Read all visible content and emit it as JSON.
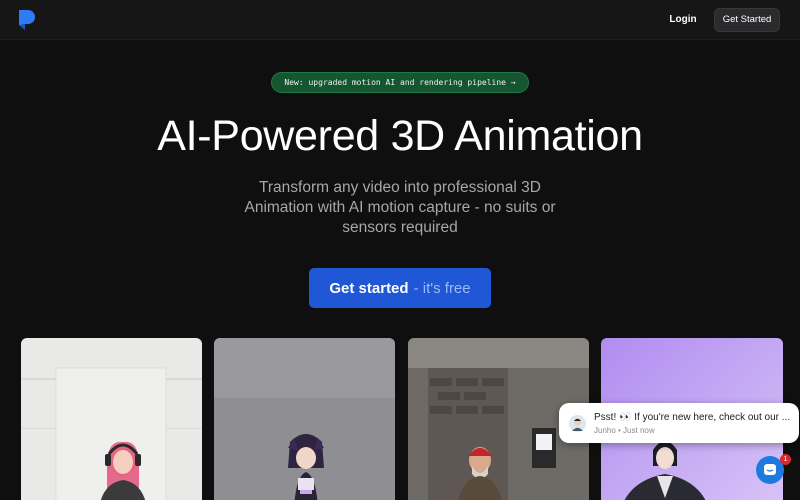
{
  "nav": {
    "logo_icon": "brand-logo-icon",
    "login_label": "Login",
    "get_started_label": "Get Started"
  },
  "announcement": {
    "text": "New: upgraded motion AI and rendering pipeline →"
  },
  "hero": {
    "title": "AI-Powered 3D Animation",
    "subtitle": "Transform any video into professional 3D Animation with AI motion capture - no suits or sensors required",
    "cta_main": "Get started",
    "cta_sub": "- it's free"
  },
  "chat": {
    "toast_message": "Psst! 👀 If you're new here, check out our ...",
    "toast_meta": "Junho • Just now",
    "badge_count": "1",
    "icon": "chat-bubble-icon"
  },
  "colors": {
    "background": "#0f0f10",
    "accent": "#1f57d6",
    "pill_green": "#16552f"
  }
}
